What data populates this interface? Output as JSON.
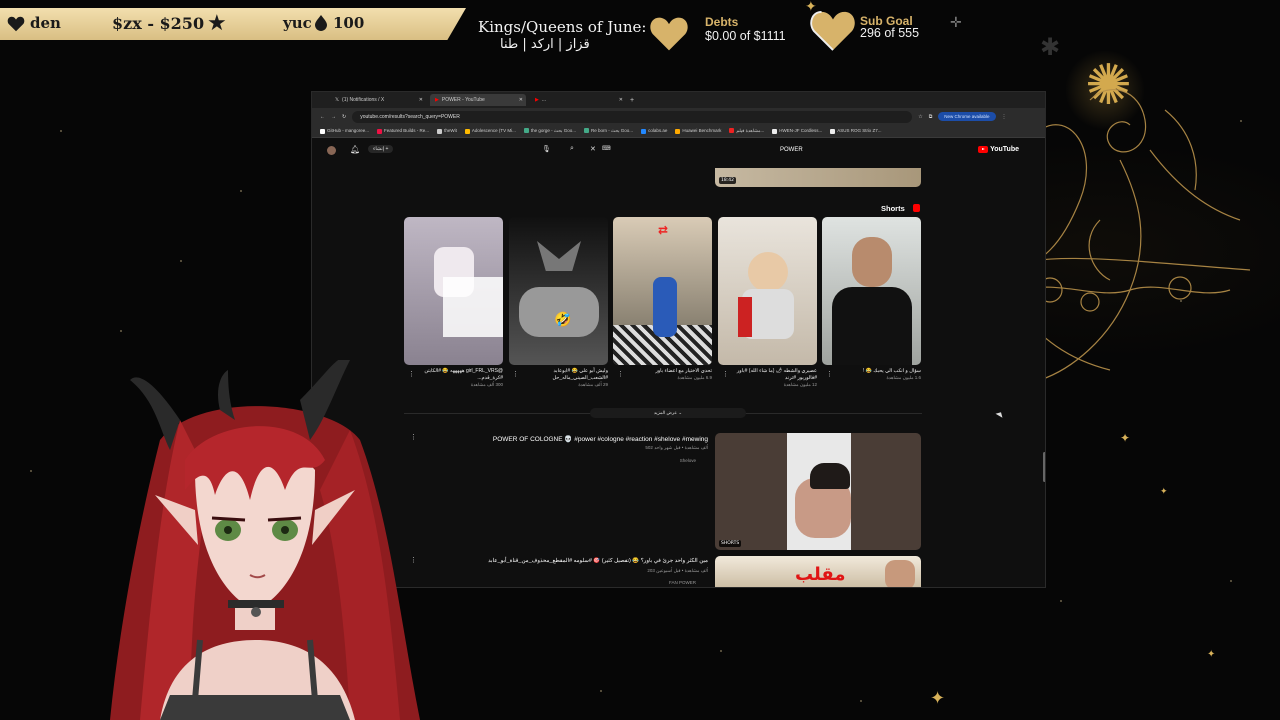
{
  "overlay": {
    "banner": {
      "item1": "den",
      "item2": "$zx - $250",
      "item3_name": "yuc",
      "item3_value": "100"
    },
    "kings_title": "Kings/Queens of June:",
    "kings_names": "قزاز | اركد | طنا",
    "debts": {
      "title": "Debts",
      "value": "$0.00 of $1111"
    },
    "sub_goal": {
      "title": "Sub Goal",
      "value": "296 of 555"
    }
  },
  "browser": {
    "tabs": [
      {
        "label": "(1) Notifications / X"
      },
      {
        "label": "POWER - YouTube"
      },
      {
        "label": "..."
      }
    ],
    "url": "youtube.com/results?search_query=POWER",
    "new_chrome": "New Chrome available",
    "bookmarks": [
      "GitHub - mangoree...",
      "Featured Builds - Re...",
      "theWit",
      "Adolescence (TV Mi...",
      "the gorge - بحث Goo...",
      "Re born - بحث Goo...",
      "colabs.ae",
      "Huawei Benchmark",
      "مشاهدة فيلم...",
      "HWEN-JF Cordless...",
      "ASUS ROG Strix Z7..."
    ]
  },
  "youtube": {
    "logo": "YouTube",
    "search_query": "POWER",
    "create_label": "إنشاء",
    "duration_top": "18:42",
    "shorts_title": "Shorts",
    "shorts": [
      {
        "title": "@girl_FRL_VRS هههههه 😂 #الكابتن #كرة_قدم...",
        "views": "300 ألف مشاهدة"
      },
      {
        "title": "وليش أبو علي 😂 #ابوعابد #الشعب_الصيني_ماله_حل",
        "views": "29 ألف مشاهدة"
      },
      {
        "title": "تحدي الاختيار مع اعضاء باور",
        "views": "6.9 مليون مشاهدة"
      },
      {
        "title": "عصيري والشطه 🌶 (ما شاء الله) #باور #فالوربور #ترند",
        "views": "12 مليون مشاهدة"
      },
      {
        "title": "سؤال و انكب الي يحبك 😂 !",
        "views": "1.6 مليون مشاهدة"
      }
    ],
    "show_more": "عرض المزيد",
    "videos": [
      {
        "title": "POWER OF COLOGNE 💀 #power #cologne #reaction #shelove #mewing",
        "meta": "502 ألف مشاهدة • قبل شهر واحد",
        "channel": "Shelove",
        "badge": "SHORTS"
      },
      {
        "title": "مين الكثر واحد جرئ في باور؟ 😂 (تفصيل كثير) 🎯 #سلومه #المقطع_محذوف_من_قناة_أبو_عابد",
        "meta": "203 ألف مشاهدة • قبل أسبوعين",
        "channel": "FAN POWER",
        "thumb_text": "مقلب"
      }
    ]
  }
}
